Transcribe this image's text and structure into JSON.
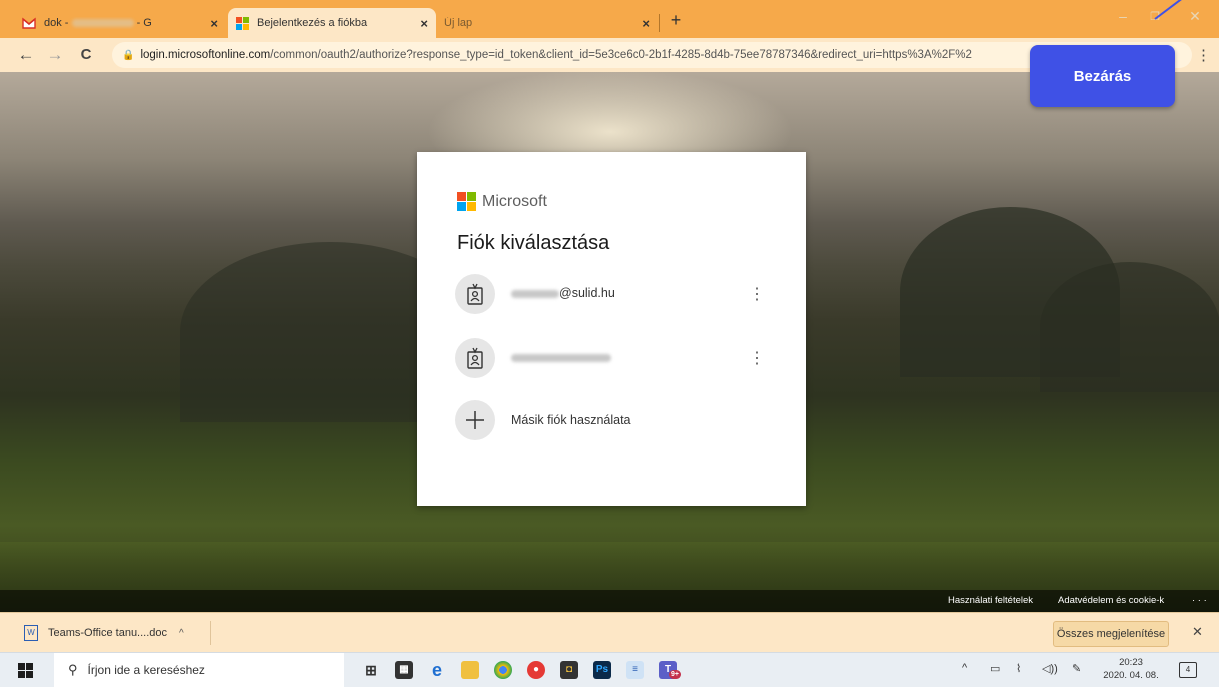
{
  "browser": {
    "tabs": [
      {
        "title": "dok - ",
        "title_blurred": "vilmosné@gmail.com",
        "title_suffix": " - G",
        "close": "×",
        "favicon": "gmail-icon"
      },
      {
        "title": "Bejelentkezés a fiókba",
        "close": "×",
        "favicon": "microsoft-icon"
      },
      {
        "title": "Új lap",
        "close": "×"
      }
    ],
    "new_tab": "+",
    "window": {
      "minimize": "–",
      "restore": "❐",
      "close": "✕"
    },
    "nav": {
      "back": "←",
      "forward": "→",
      "reload": "C"
    },
    "url": {
      "domain": "login.microsoftonline.com",
      "path": "/common/oauth2/authorize?response_type=id_token&client_id=5e3ce6c0-2b1f-4285-8d4b-75ee78787346&redirect_uri=https%3A%2F%2"
    },
    "menu": "⋮"
  },
  "callout": {
    "label": "Bezárás"
  },
  "dialog": {
    "brand": "Microsoft",
    "brand_colors": [
      "#f25022",
      "#7fba00",
      "#00a4ef",
      "#ffb900"
    ],
    "title": "Fiók kiválasztása",
    "accounts": [
      {
        "email_suffix": "@sulid.hu",
        "menu": "⋮",
        "icon": "badge-person-icon"
      },
      {
        "email_suffix": "",
        "menu": "⋮",
        "icon": "badge-person-icon"
      }
    ],
    "other_account": {
      "label": "Másik fiók használata",
      "icon": "plus-icon"
    }
  },
  "footer": {
    "terms": "Használati feltételek",
    "privacy": "Adatvédelem és cookie-k",
    "more": "· · ·"
  },
  "downloads": {
    "item": {
      "name": "Teams-Office tanu....doc",
      "chevron": "^"
    },
    "show_all": "Összes megjelenítése",
    "close": "✕"
  },
  "taskbar": {
    "search_placeholder": "Írjon ide a kereséshez",
    "search_icon": "⚲",
    "apps": [
      "task-view-icon",
      "store-icon",
      "edge-icon",
      "file-explorer-icon",
      "chrome-icon",
      "screen-recorder-icon",
      "app-icon",
      "photoshop-icon",
      "notepad-icon",
      "teams-icon"
    ],
    "teams_badge": "9+",
    "tray": {
      "chevron": "^",
      "time": "20:23",
      "date": "2020. 04. 08.",
      "notifications": "4"
    }
  }
}
